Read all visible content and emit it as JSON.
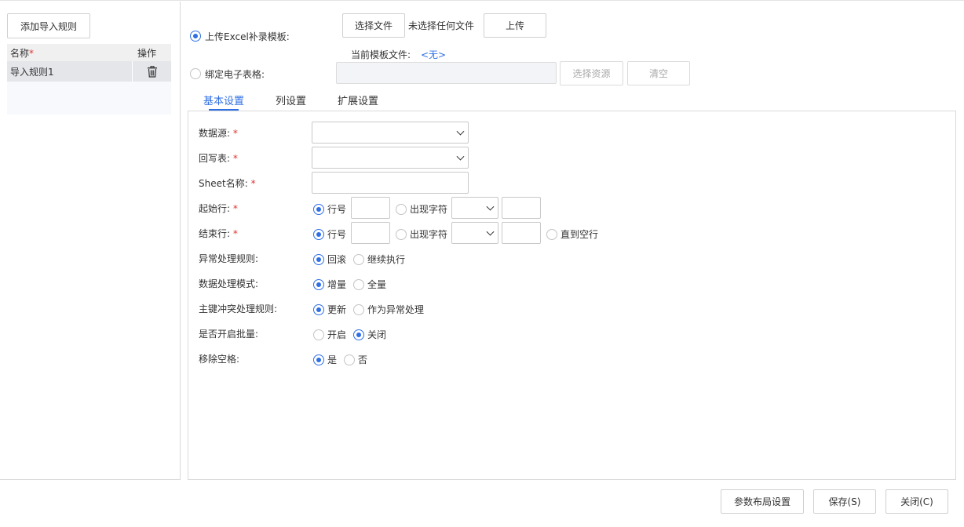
{
  "left": {
    "add_rule_button": "添加导入规则",
    "table": {
      "col_name": "名称",
      "col_name_required": "*",
      "col_ops": "操作",
      "rows": [
        {
          "name": "导入规则1"
        }
      ]
    }
  },
  "upload": {
    "upload_excel_label": "上传Excel补录模板:",
    "choose_file_button": "选择文件",
    "no_file_text": "未选择任何文件",
    "upload_button": "上传",
    "current_template_label": "当前模板文件:",
    "current_template_value": "<无>",
    "bind_sheet_label": "绑定电子表格:",
    "select_resource_button": "选择资源",
    "clear_button": "清空"
  },
  "tabs": [
    "基本设置",
    "列设置",
    "扩展设置"
  ],
  "form": {
    "datasource_label": "数据源:",
    "writeback_label": "回写表:",
    "sheet_label": "Sheet名称:",
    "start_row_label": "起始行:",
    "end_row_label": "结束行:",
    "exception_label": "异常处理规则:",
    "mode_label": "数据处理模式:",
    "pk_label": "主键冲突处理规则:",
    "batch_label": "是否开启批量:",
    "trim_label": "移除空格:",
    "required_mark": "*",
    "row_no": "行号",
    "appear_char": "出现字符",
    "until_empty": "直到空行",
    "rollback": "回滚",
    "continue": "继续执行",
    "incremental": "增量",
    "full": "全量",
    "update": "更新",
    "as_exception": "作为异常处理",
    "enable": "开启",
    "disable": "关闭",
    "yes": "是",
    "no": "否"
  },
  "footer": {
    "layout_button": "参数布局设置",
    "save_button": "保存(S)",
    "close_button": "关闭(C)"
  },
  "colors": {
    "accent": "#2f6fe4",
    "required": "#e6312e"
  }
}
